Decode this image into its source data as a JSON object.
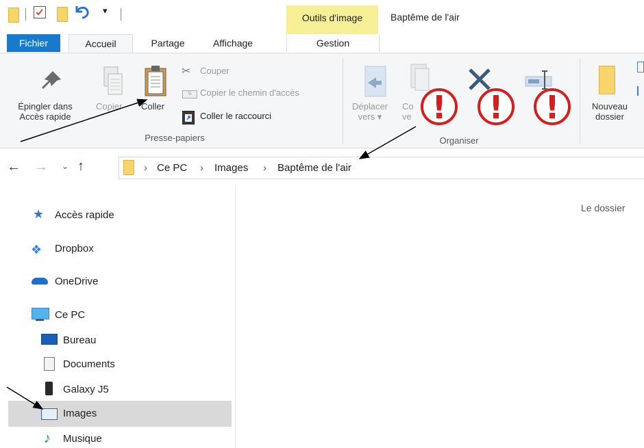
{
  "window": {
    "title": "Baptême de l'air",
    "context_tab": "Outils d'image"
  },
  "tabs": {
    "file": "Fichier",
    "home": "Accueil",
    "share": "Partage",
    "view": "Affichage",
    "manage": "Gestion"
  },
  "ribbon": {
    "pin": {
      "line1": "Épingler dans",
      "line2": "Accès rapide"
    },
    "copy": "Copier",
    "paste": "Coller",
    "cut": "Couper",
    "copy_path": "Copier le chemin d'accès",
    "paste_shortcut": "Coller le raccourci",
    "group_clipboard": "Presse-papiers",
    "move": {
      "line1": "Déplacer",
      "line2": "vers ▾"
    },
    "copy_to": {
      "line1": "Co",
      "line2": "ve"
    },
    "group_organize": "Organiser",
    "new_folder": {
      "line1": "Nouveau",
      "line2": "dossier"
    }
  },
  "address": {
    "crumbs": [
      "Ce PC",
      "Images",
      "Baptême de l'air"
    ]
  },
  "content": {
    "empty_text": "Le dossier"
  },
  "navpane": {
    "items": [
      {
        "label": "Accès rapide",
        "icon": "star-icon"
      },
      {
        "label": "Dropbox",
        "icon": "dropbox-icon"
      },
      {
        "label": "OneDrive",
        "icon": "cloud-icon"
      },
      {
        "label": "Ce PC",
        "icon": "computer-icon"
      },
      {
        "label": "Bureau",
        "icon": "desktop-icon"
      },
      {
        "label": "Documents",
        "icon": "documents-icon"
      },
      {
        "label": "Galaxy J5",
        "icon": "phone-icon"
      },
      {
        "label": "Images",
        "icon": "pictures-icon",
        "selected": true
      },
      {
        "label": "Musique",
        "icon": "music-icon"
      }
    ]
  },
  "colors": {
    "accent": "#1979ca",
    "context": "#f6ef96",
    "alert": "#d3201f",
    "selected": "#d9d9d9"
  }
}
